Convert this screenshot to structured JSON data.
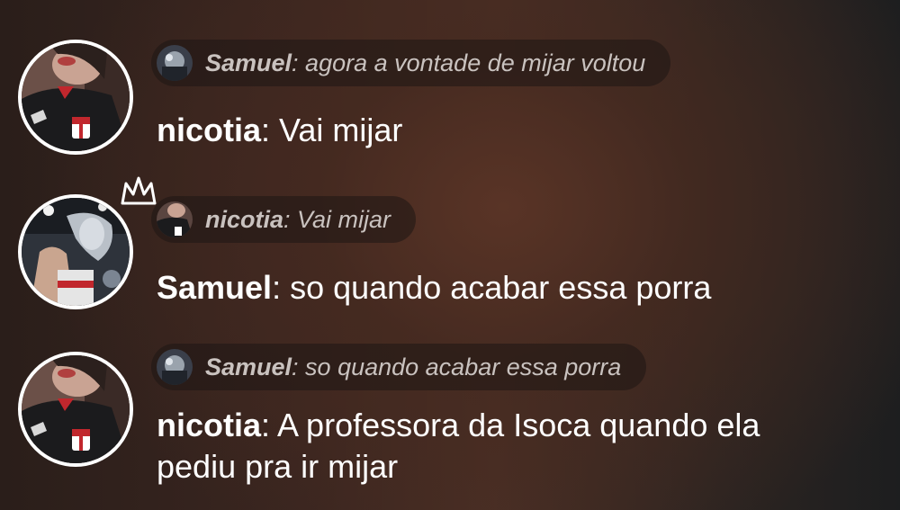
{
  "messages": [
    {
      "quote": {
        "author": "Samuel",
        "text": ": agora a vontade de mijar voltou"
      },
      "author": "nicotia",
      "text": ": Vai mijar",
      "avatar_icon": "user-avatar-nicotia"
    },
    {
      "quote": {
        "author": "nicotia",
        "text": ": Vai mijar"
      },
      "author": "Samuel",
      "text": ": so quando acabar essa porra",
      "avatar_icon": "user-avatar-samuel",
      "badge_icon": "crown-icon"
    },
    {
      "quote": {
        "author": "Samuel",
        "text": ": so quando acabar essa porra"
      },
      "author": "nicotia",
      "text": ": A professora da Isoca quando ela pediu pra ir mijar",
      "avatar_icon": "user-avatar-nicotia"
    }
  ],
  "colors": {
    "quote_text": "#c9c2bf",
    "message_text": "#ffffff",
    "avatar_border": "#ffffff"
  }
}
